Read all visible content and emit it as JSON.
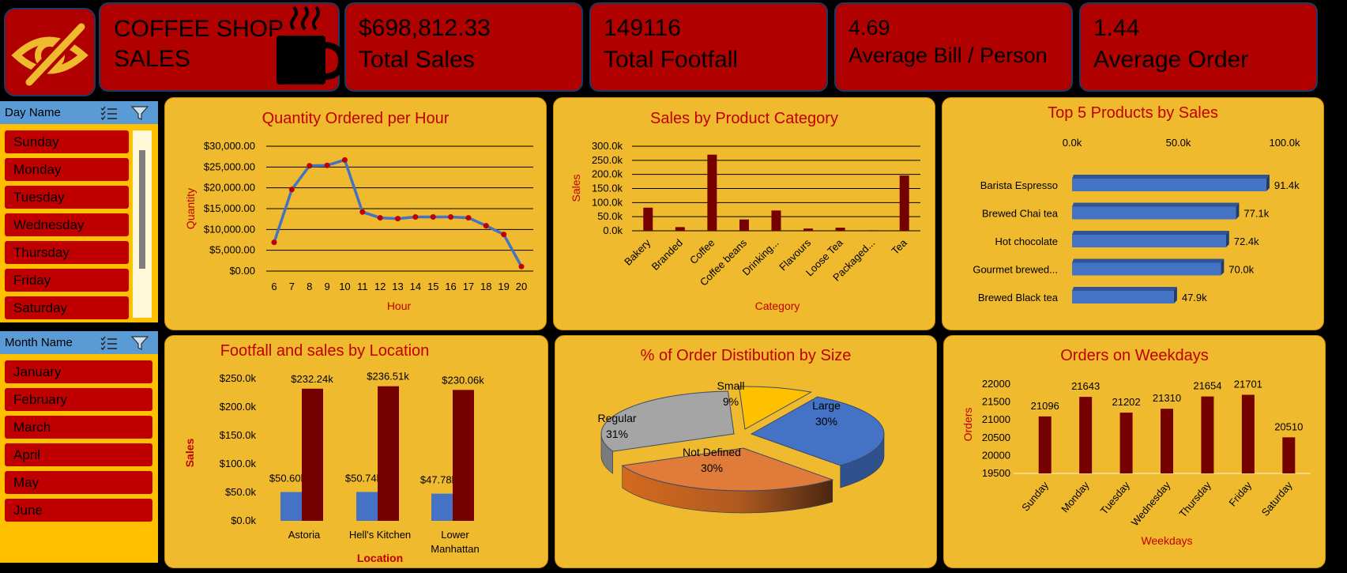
{
  "kpis": {
    "title_line1": "COFFEE SHOP",
    "title_line2": "SALES",
    "total_sales_value": "$698,812.33",
    "total_sales_label": "Total Sales",
    "footfall_value": "149116",
    "footfall_label": "Total Footfall",
    "avg_bill_value": "4.69",
    "avg_bill_label": "Average  Bill / Person",
    "avg_order_value": "1.44",
    "avg_order_label": "Average Order"
  },
  "icons": {
    "logo": "eye-slash-icon",
    "cup": "coffee-cup-icon",
    "multiselect": "multi-select-icon",
    "filter": "clear-filter-icon"
  },
  "colors": {
    "kpi_bg": "#b00000",
    "panel_bg": "#f0ba2e",
    "slicer_bg": "#ffc000",
    "slicer_head": "#5b9bd5",
    "item": "#c00000",
    "accent": "#c00000",
    "bar_dark": "#750000",
    "bar_blue": "#4472c4",
    "line": "#4472c4"
  },
  "day_slicer": {
    "title": "Day Name",
    "items": [
      "Sunday",
      "Monday",
      "Tuesday",
      "Wednesday",
      "Thursday",
      "Friday",
      "Saturday"
    ]
  },
  "month_slicer": {
    "title": "Month Name",
    "items": [
      "January",
      "February",
      "March",
      "April",
      "May",
      "June"
    ]
  },
  "chart_data": [
    {
      "type": "line",
      "title": "Quantity Ordered per Hour",
      "xlabel": "Hour",
      "ylabel": "Quantity",
      "x": [
        6,
        7,
        8,
        9,
        10,
        11,
        12,
        13,
        14,
        15,
        16,
        17,
        18,
        19,
        20
      ],
      "values": [
        6900,
        19600,
        25300,
        25400,
        26700,
        14200,
        12800,
        12600,
        13000,
        13000,
        13000,
        12800,
        10900,
        8800,
        1100
      ],
      "ylim": [
        0,
        30000
      ],
      "yticks": [
        "$0.00",
        "$5,000.00",
        "$10,000.00",
        "$15,000.00",
        "$20,000.00",
        "$25,000.00",
        "$30,000.00"
      ],
      "grid": true
    },
    {
      "type": "bar",
      "title": "Sales by Product Category",
      "xlabel": "Category",
      "ylabel": "Sales",
      "categories": [
        "Bakery",
        "Branded",
        "Coffee",
        "Coffee beans",
        "Drinking...",
        "Flavours",
        "Loose Tea",
        "Packaged...",
        "Tea"
      ],
      "values": [
        82000,
        13000,
        270000,
        40000,
        72000,
        8000,
        11000,
        2000,
        196000
      ],
      "ylim": [
        0,
        300000
      ],
      "yticks": [
        "0.0k",
        "50.0k",
        "100.0k",
        "150.0k",
        "200.0k",
        "250.0k",
        "300.0k"
      ],
      "grid": true
    },
    {
      "type": "bar",
      "orientation": "horizontal",
      "title": "Top 5 Products by Sales",
      "categories": [
        "Barista Espresso",
        "Brewed Chai tea",
        "Hot chocolate",
        "Gourmet brewed...",
        "Brewed Black tea"
      ],
      "values": [
        91400,
        77100,
        72400,
        70000,
        47900
      ],
      "labels": [
        "91.4k",
        "77.1k",
        "72.4k",
        "70.0k",
        "47.9k"
      ],
      "xlim": [
        0,
        100000
      ],
      "xticks": [
        "0.0k",
        "50.0k",
        "100.0k"
      ]
    },
    {
      "type": "bar",
      "title": "Footfall and sales by Location",
      "xlabel": "Location",
      "ylabel": "Sales",
      "categories": [
        "Astoria",
        "Hell's Kitchen",
        "Lower Manhattan"
      ],
      "category_lines": [
        [
          "Astoria"
        ],
        [
          "Hell's Kitchen"
        ],
        [
          "Lower",
          "Manhattan"
        ]
      ],
      "series": [
        {
          "values": [
            50600,
            50740,
            47780
          ],
          "labels": [
            "$50.60k",
            "$50.74k",
            "$47.78k"
          ]
        },
        {
          "values": [
            232240,
            236510,
            230060
          ],
          "labels": [
            "$232.24k",
            "$236.51k",
            "$230.06k"
          ]
        }
      ],
      "ylim": [
        0,
        250000
      ],
      "yticks": [
        "$0.0k",
        "$50.0k",
        "$100.0k",
        "$150.0k",
        "$200.0k",
        "$250.0k"
      ]
    },
    {
      "type": "pie",
      "title": "% of Order Distibution by Size",
      "slices": [
        {
          "label": "Large",
          "percent": "30%",
          "value": 30
        },
        {
          "label": "Not Defined",
          "percent": "30%",
          "value": 30
        },
        {
          "label": "Regular",
          "percent": "31%",
          "value": 31
        },
        {
          "label": "Small",
          "percent": "9%",
          "value": 9
        }
      ]
    },
    {
      "type": "bar",
      "title": "Orders on Weekdays",
      "xlabel": "Weekdays",
      "ylabel": "Orders",
      "categories": [
        "Sunday",
        "Monday",
        "Tuesday",
        "Wednesday",
        "Thursday",
        "Friday",
        "Saturday"
      ],
      "values": [
        21096,
        21643,
        21202,
        21310,
        21654,
        21701,
        20510
      ],
      "labels": [
        "21096",
        "21643",
        "21202",
        "21310",
        "21654",
        "21701",
        "20510"
      ],
      "ylim": [
        19500,
        22000
      ],
      "yticks": [
        "19500",
        "20000",
        "20500",
        "21000",
        "21500",
        "22000"
      ]
    }
  ]
}
